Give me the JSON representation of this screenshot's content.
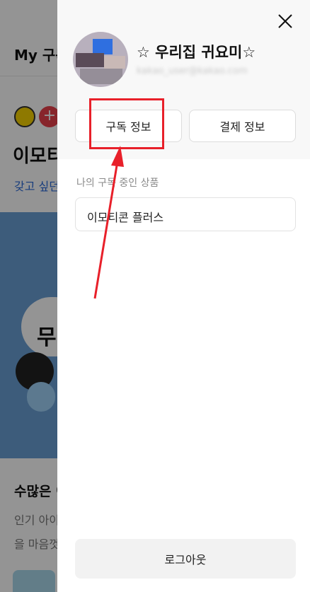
{
  "background": {
    "header_title": "My 구독",
    "heading": "이모티",
    "link_text": "갖고 싶던",
    "bubble_text": "무",
    "subheading": "수많은 이",
    "desc_line1": "인기 아이",
    "desc_line2": "을 마음껏"
  },
  "drawer": {
    "profile": {
      "name": "☆ 우리집 귀요미☆",
      "email": "kakao_user@kakao.com"
    },
    "tabs": {
      "subscription": "구독 정보",
      "payment": "결제 정보"
    },
    "section_label": "나의 구독 중인 상품",
    "product": "이모티콘 플러스",
    "logout": "로그아웃"
  },
  "colors": {
    "annotation": "#e8202a",
    "banner": "#6a9fd4"
  }
}
